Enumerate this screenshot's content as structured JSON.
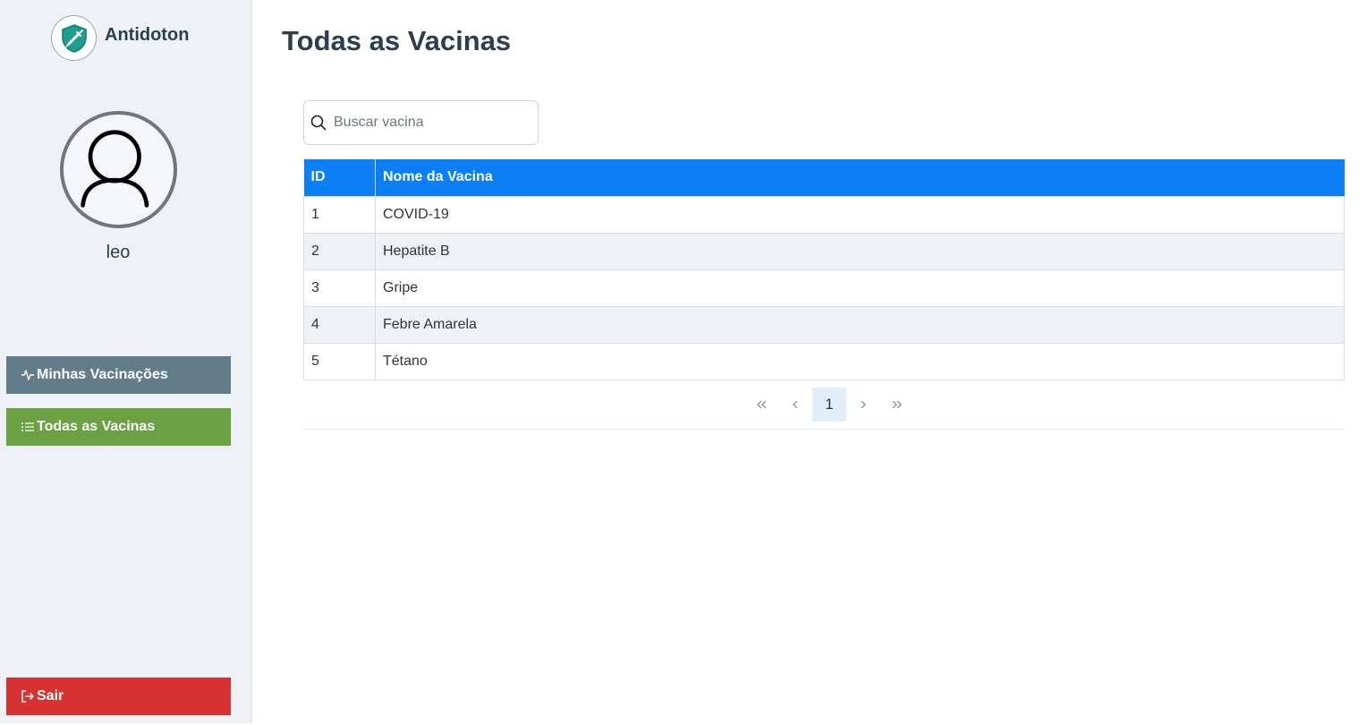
{
  "app": {
    "name": "Antidoton"
  },
  "user": {
    "name": "leo"
  },
  "nav": {
    "minhas_label": "Minhas Vacinações",
    "todas_label": "Todas as Vacinas",
    "sair_label": "Sair"
  },
  "page": {
    "title": "Todas as Vacinas"
  },
  "search": {
    "placeholder": "Buscar vacina",
    "value": ""
  },
  "table": {
    "headers": [
      "ID",
      "Nome da Vacina"
    ],
    "rows": [
      [
        "1",
        "COVID-19"
      ],
      [
        "2",
        "Hepatite B"
      ],
      [
        "3",
        "Gripe"
      ],
      [
        "4",
        "Febre Amarela"
      ],
      [
        "5",
        "Tétano"
      ]
    ]
  },
  "pagination": {
    "first": "«",
    "prev": "‹",
    "current": "1",
    "next": "›",
    "last": "»"
  },
  "colors": {
    "header_blue": "#0d7ff5",
    "minhas_bg": "#627d89",
    "todas_bg": "#6ba043",
    "sair_bg": "#d63232"
  }
}
